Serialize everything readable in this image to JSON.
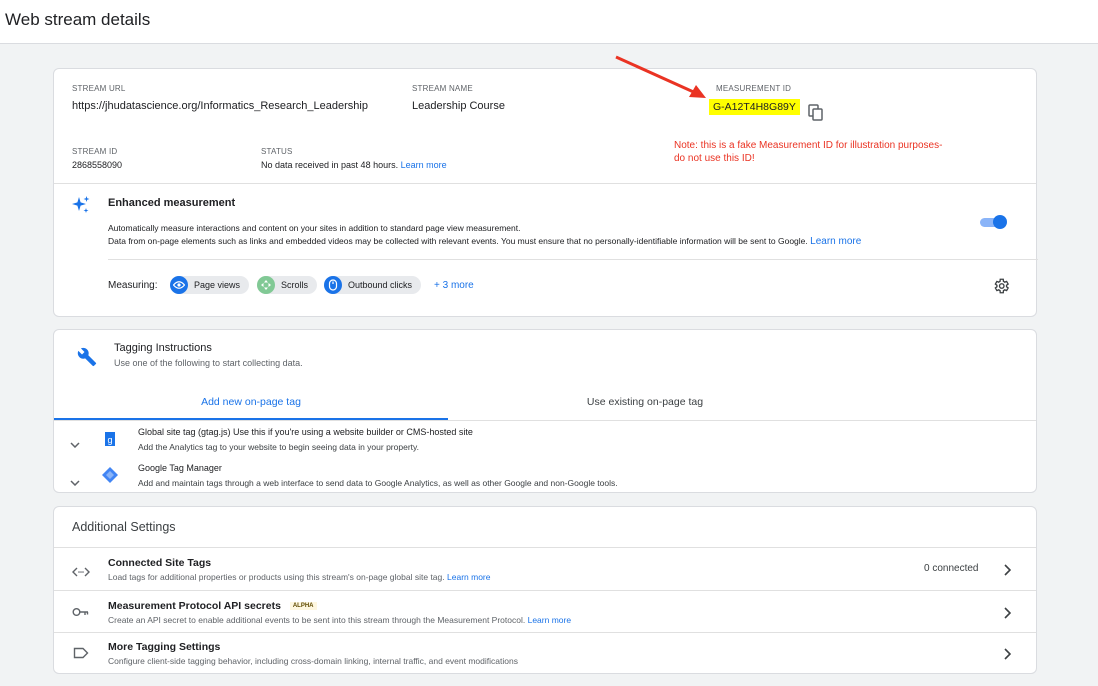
{
  "header": {
    "title": "Web stream details"
  },
  "stream": {
    "url_label": "STREAM URL",
    "url": "https://jhudatascience.org/Informatics_Research_Leadership",
    "name_label": "STREAM NAME",
    "name": "Leadership Course",
    "mid_label": "MEASUREMENT ID",
    "mid": "G-A12T4H8G89Y",
    "id_label": "STREAM ID",
    "id": "2868558090",
    "status_label": "STATUS",
    "status": "No data received in past 48 hours.",
    "status_link": "Learn more",
    "note": "Note: this is a fake Measurement ID  for illustration purposes- do not use this ID!"
  },
  "enhanced": {
    "title": "Enhanced measurement",
    "desc1": "Automatically measure interactions and content on your sites in addition to standard page view measurement.",
    "desc2": "Data from on-page elements such as links and embedded videos may be collected with relevant events. You must ensure that no personally-identifiable information will be sent to Google.",
    "desc2_link": "Learn more",
    "toggle_on": true,
    "measuring_label": "Measuring:",
    "chips": [
      "Page views",
      "Scrolls",
      "Outbound clicks"
    ],
    "more": "+ 3 more"
  },
  "tagging": {
    "title": "Tagging Instructions",
    "subtitle": "Use one of the following to start collecting data.",
    "tabs": [
      "Add new on-page tag",
      "Use existing on-page tag"
    ],
    "items": [
      {
        "title_bold": "Global site tag (gtag.js)",
        "title_rest": " Use this if you're using a website builder or CMS-hosted site",
        "desc": "Add the Analytics tag to your website to begin seeing data in your property."
      },
      {
        "title_bold": "Google Tag Manager",
        "title_rest": "",
        "desc": "Add and maintain tags through a web interface to send data to Google Analytics, as well as other Google and non-Google tools."
      }
    ]
  },
  "additional": {
    "title": "Additional Settings",
    "rows": [
      {
        "title": "Connected Site Tags",
        "desc": "Load tags for additional properties or products using this stream's on-page global site tag.",
        "link": "Learn more",
        "right": "0 connected"
      },
      {
        "title": "Measurement Protocol API secrets",
        "badge": "ALPHA",
        "desc": "Create an API secret to enable additional events to be sent into this stream through the Measurement Protocol.",
        "link": "Learn more"
      },
      {
        "title": "More Tagging Settings",
        "desc": "Configure client-side tagging behavior, including cross-domain linking, internal traffic, and event modifications"
      }
    ]
  },
  "colors": {
    "accent": "#1a73e8",
    "highlight": "#ffff00",
    "annotation": "#ea3323"
  }
}
